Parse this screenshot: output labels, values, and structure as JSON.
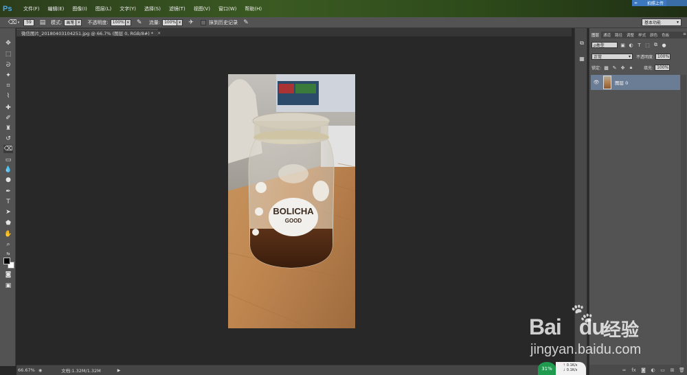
{
  "app": {
    "logo": "Ps",
    "menu": [
      "文件(F)",
      "编辑(E)",
      "图像(I)",
      "图层(L)",
      "文字(Y)",
      "选择(S)",
      "滤镜(T)",
      "视图(V)",
      "窗口(W)",
      "帮助(H)"
    ],
    "upload_label": "拍照上传"
  },
  "options_bar": {
    "brush_size": "59",
    "mode_label": "模式:",
    "mode_value": "画笔",
    "opacity_label": "不透明度:",
    "opacity_value": "100%",
    "flow_label": "流量:",
    "flow_value": "100%",
    "erase_history_label": "抹到历史记录",
    "workspace": "基本功能"
  },
  "document": {
    "tab_title": "微信图片_20180403104251.jpg @ 66.7% (图层 0, RGB/8#) *",
    "tab_close": "×",
    "photo_label_top": "BOLICHA",
    "photo_label_bottom": "GOOD"
  },
  "status_bar": {
    "zoom": "66.67%",
    "doc_size": "文档:1.32M/1.32M",
    "arrow": "▶"
  },
  "layers_panel": {
    "tabs": [
      "图层",
      "通道",
      "路径",
      "调整",
      "样式",
      "颜色",
      "色板"
    ],
    "filter_value": "ρ类型",
    "blend_mode": "正常",
    "opacity_label": "不透明度:",
    "opacity_value": "100%",
    "lock_label": "锁定:",
    "fill_label": "填充:",
    "fill_value": "100%",
    "layer_name": "图层 0"
  },
  "net_widget": {
    "cpu": "31%",
    "up_speed": "0.1K/s",
    "down_speed": "0.1K/s"
  },
  "watermark": {
    "brand": "Bai",
    "brand_tail": "du",
    "chinese": "经验",
    "url": "jingyan.baidu.com"
  },
  "colors": {
    "accent": "#4aa8e8",
    "selected_layer": "#6b7c95",
    "cpu_green": "#1f9a4e"
  }
}
